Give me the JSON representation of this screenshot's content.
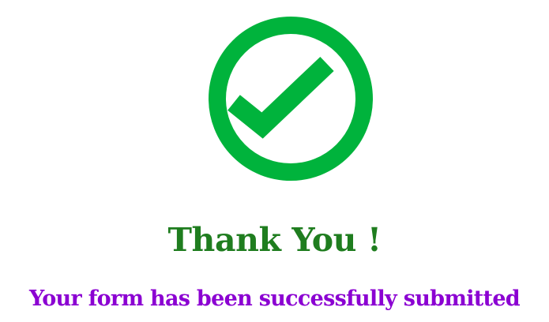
{
  "success_icon": {
    "name": "check-circle-icon",
    "color": "#00b33c"
  },
  "message": {
    "title": "Thank You !",
    "subtitle": "Your form has been successfully submitted"
  },
  "colors": {
    "title": "#1f7d1f",
    "subtitle": "#8b00d2",
    "background": "#ffffff"
  }
}
